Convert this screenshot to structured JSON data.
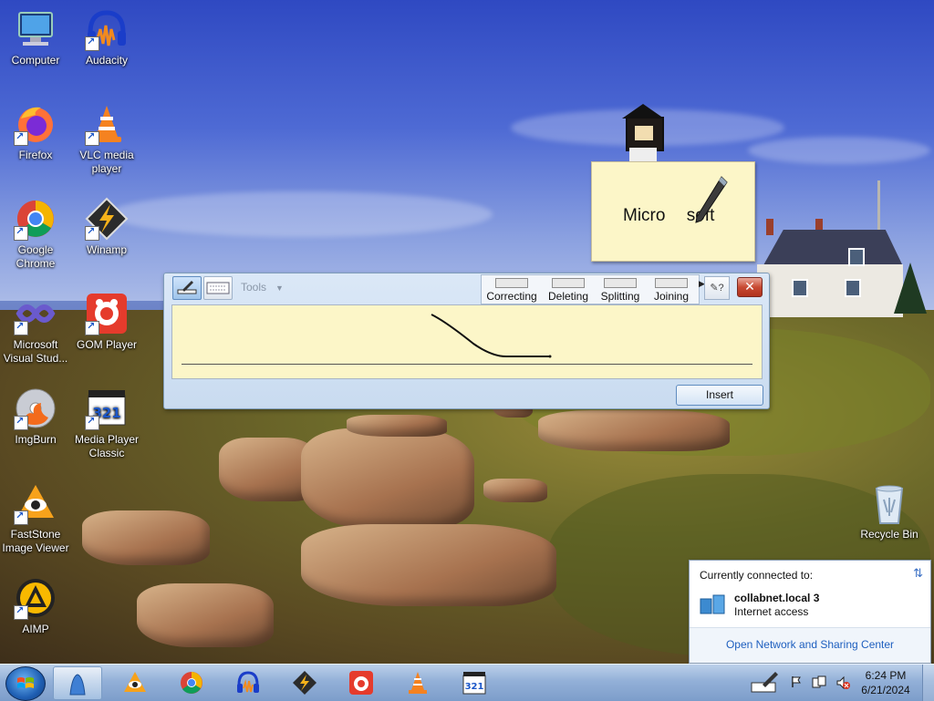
{
  "desktop": {
    "icons": [
      {
        "label": "Computer",
        "icon": "computer-icon"
      },
      {
        "label": "Audacity",
        "icon": "audacity-icon"
      },
      {
        "label": "Firefox",
        "icon": "firefox-icon"
      },
      {
        "label": "VLC media player",
        "icon": "vlc-icon"
      },
      {
        "label": "Google Chrome",
        "icon": "chrome-icon"
      },
      {
        "label": "Winamp",
        "icon": "winamp-icon"
      },
      {
        "label": "Microsoft Visual Stud...",
        "icon": "visual-studio-icon"
      },
      {
        "label": "GOM Player",
        "icon": "gom-player-icon"
      },
      {
        "label": "ImgBurn",
        "icon": "imgburn-icon"
      },
      {
        "label": "Media Player Classic",
        "icon": "media-player-classic-icon"
      },
      {
        "label": "FastStone Image Viewer",
        "icon": "faststone-icon"
      },
      {
        "label": "AIMP",
        "icon": "aimp-icon"
      },
      {
        "label": "Recycle Bin",
        "icon": "recycle-bin-icon"
      }
    ]
  },
  "preview": {
    "text": "Micro soft"
  },
  "input_panel": {
    "tools_label": "Tools",
    "gestures": [
      "Correcting",
      "Deleting",
      "Splitting",
      "Joining"
    ],
    "insert_label": "Insert",
    "close_glyph": "✕"
  },
  "network_popup": {
    "header": "Currently connected to:",
    "network_name": "collabnet.local  3",
    "network_status": "Internet access",
    "link": "Open Network and Sharing Center"
  },
  "taskbar": {
    "pinned": [
      "tablet-input-panel-icon",
      "faststone-icon",
      "chrome-icon",
      "audacity-icon",
      "winamp-icon",
      "gom-player-icon",
      "vlc-icon",
      "media-player-classic-icon"
    ],
    "time": "6:24 PM",
    "date": "6/21/2024"
  }
}
